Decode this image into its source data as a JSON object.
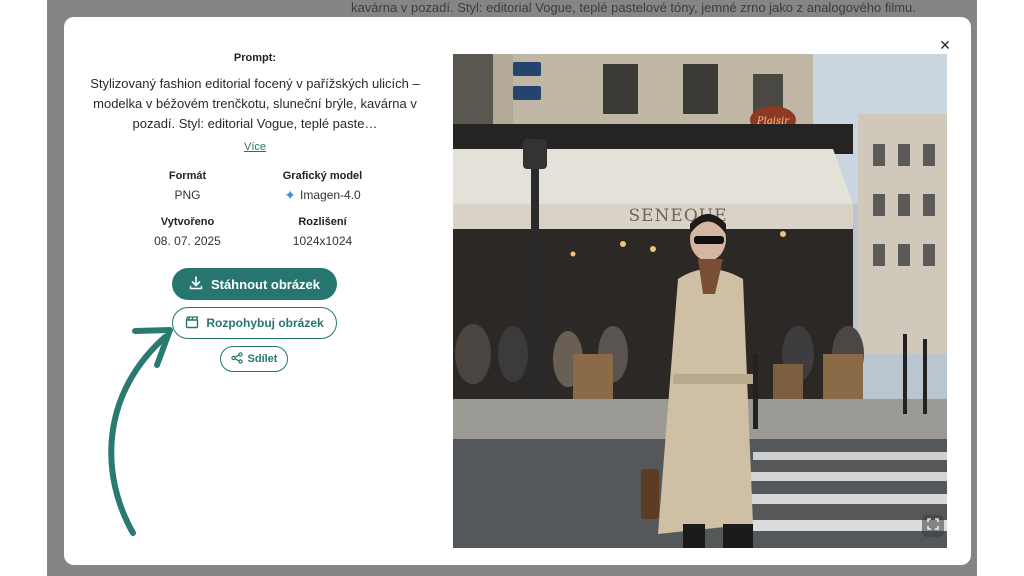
{
  "background_text": "kavárna v pozadí. Styl: editorial Vogue, teplé pastelové tóny, jemné zrno jako z analogového filmu.",
  "modal": {
    "close_label": "×",
    "prompt_label": "Prompt:",
    "prompt_text": "Stylizovaný fashion editorial focený v pařížských ulicích – modelka v béžovém trenčkotu, sluneční brýle, kavárna v pozadí. Styl: editorial Vogue, teplé paste…",
    "more_link": "Více",
    "meta": {
      "format_label": "Formát",
      "format_value": "PNG",
      "model_label": "Grafický model",
      "model_value": "Imagen-4.0",
      "created_label": "Vytvořeno",
      "created_value": "08. 07. 2025",
      "resolution_label": "Rozlišení",
      "resolution_value": "1024x1024"
    },
    "buttons": {
      "download": "Stáhnout obrázek",
      "animate": "Rozpohybuj obrázek",
      "share": "Sdílet"
    }
  },
  "image": {
    "cafe_sign": "SENEQUE",
    "round_sign": "Plaisir"
  },
  "colors": {
    "accent": "#26766f",
    "backdrop": "#858585",
    "sparkle": "#4a86e8"
  },
  "icons": {
    "close": "close-icon",
    "download": "download-icon",
    "animate": "clapperboard-icon",
    "share": "share-icon",
    "model": "sparkle-icon",
    "expand": "expand-icon"
  }
}
